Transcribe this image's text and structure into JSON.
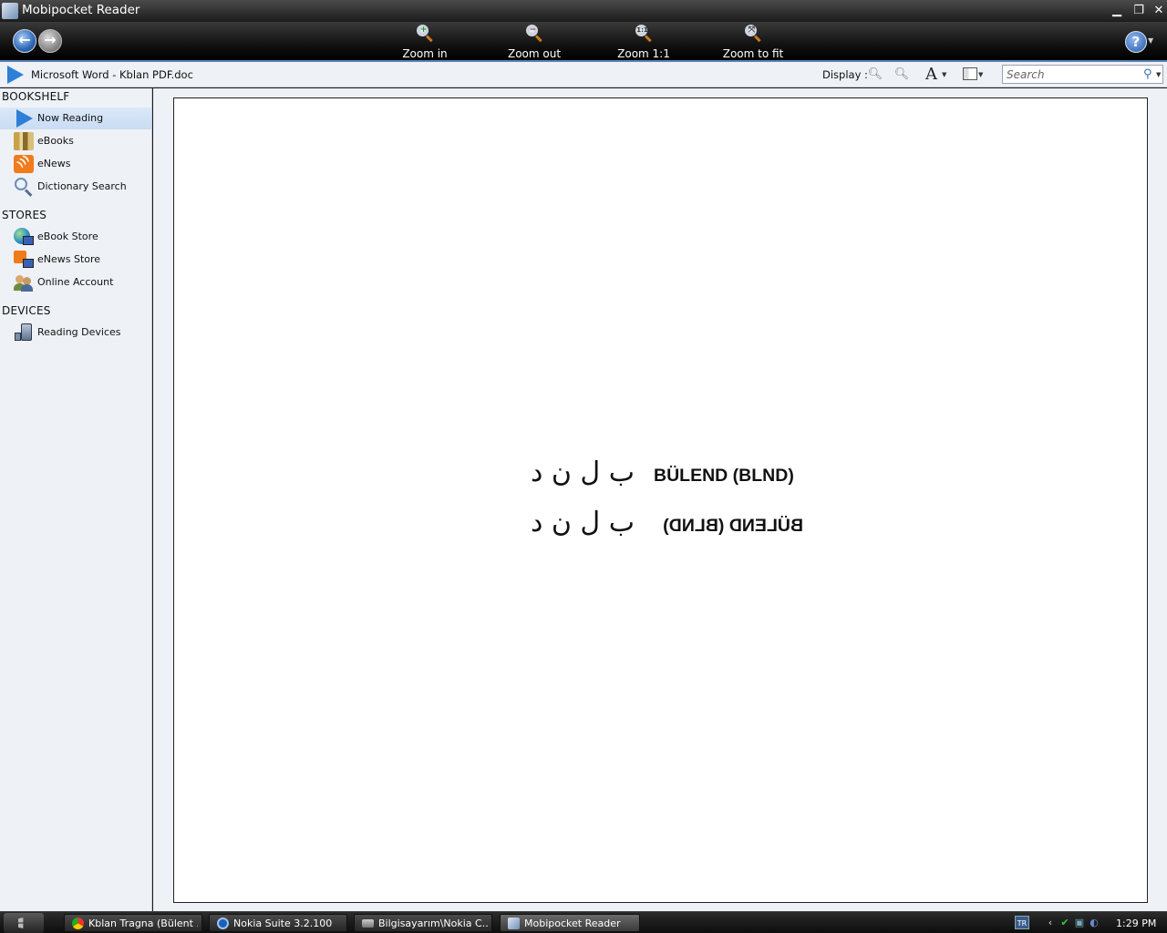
{
  "window": {
    "title": "Mobipocket Reader"
  },
  "toolbar": {
    "zoom_in": "Zoom in",
    "zoom_out": "Zoom out",
    "zoom_1to1": "Zoom 1:1",
    "zoom_fit": "Zoom to fit",
    "help": "?"
  },
  "docbar": {
    "document_title": "Microsoft Word - Kblan PDF.doc",
    "display_label": "Display :",
    "search_placeholder": "Search"
  },
  "sidebar": {
    "bookshelf_heading": "BOOKSHELF",
    "stores_heading": "STORES",
    "devices_heading": "DEVICES",
    "bookshelf_items": [
      {
        "label": "Now Reading",
        "icon": "now-reading-icon",
        "active": true
      },
      {
        "label": "eBooks",
        "icon": "ebooks-icon"
      },
      {
        "label": "eNews",
        "icon": "rss-icon"
      },
      {
        "label": "Dictionary Search",
        "icon": "magnifier-icon"
      }
    ],
    "store_items": [
      {
        "label": "eBook Store",
        "icon": "globe-icon"
      },
      {
        "label": "eNews Store",
        "icon": "rss-store-icon"
      },
      {
        "label": "Online Account",
        "icon": "people-icon"
      }
    ],
    "device_items": [
      {
        "label": "Reading Devices",
        "icon": "device-icon"
      }
    ]
  },
  "page": {
    "line1_arabic": "ب ل ن د",
    "line1_latin": "BÜLEND (BLND)",
    "line2_arabic": "ب ل ن د",
    "line2_latin": "BÜLEND (BLND)"
  },
  "taskbar": {
    "tasks": [
      {
        "label": "Kblan Tragna (Bülent ...",
        "icon": "chrome-icon"
      },
      {
        "label": "Nokia Suite 3.2.100",
        "icon": "nokia-suite-icon"
      },
      {
        "label": "Bilgisayarım\\Nokia C...",
        "icon": "explorer-icon"
      },
      {
        "label": "Mobipocket Reader",
        "icon": "mobipocket-icon",
        "active": true
      }
    ],
    "language": "TR",
    "clock": "1:29 PM"
  },
  "colors": {
    "accent_blue": "#2d7fd8",
    "sidebar_bg": "#eef1f6",
    "rss_orange": "#f07b1a"
  }
}
